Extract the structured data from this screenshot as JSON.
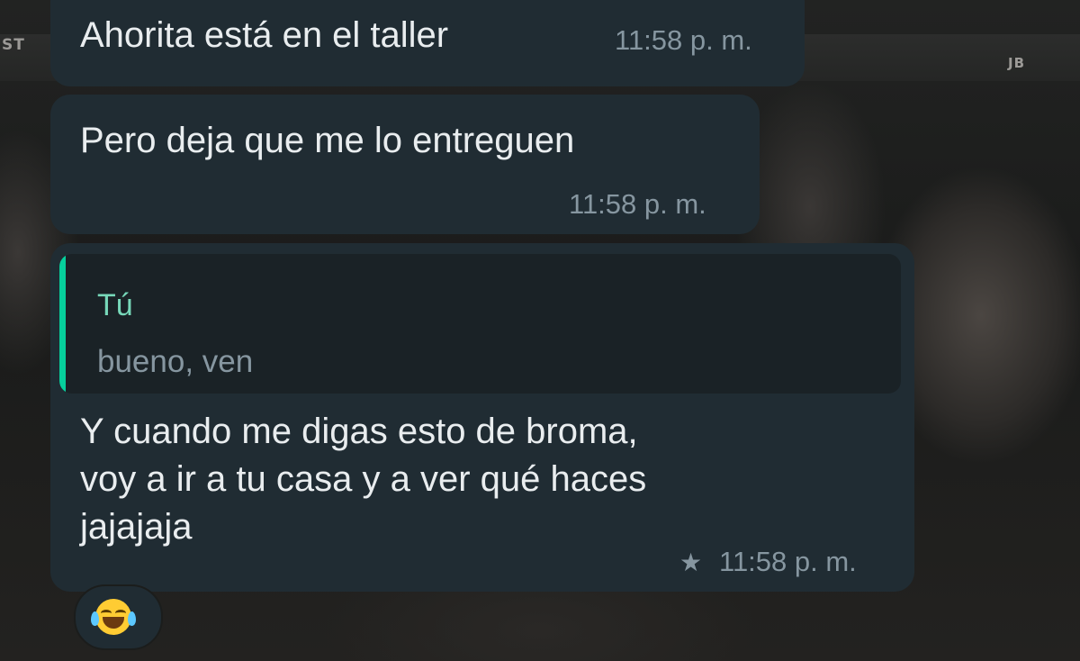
{
  "wallpaper": {
    "tag_left": "ST",
    "tag_right": "JB"
  },
  "messages": [
    {
      "text": "Ahorita está en el taller",
      "time": "11:58 p. m."
    },
    {
      "text": "Pero deja que me lo entreguen",
      "time": "11:58 p. m."
    },
    {
      "quote": {
        "author": "Tú",
        "text": "bueno, ven"
      },
      "lines": [
        "Y cuando me digas esto de broma,",
        "voy a ir a tu casa y a ver qué haces",
        "jajajaja"
      ],
      "starred": true,
      "star_icon": "star-icon",
      "time": "11:58 p. m."
    }
  ],
  "reaction": {
    "emoji_name": "face-with-tears-of-joy-icon"
  },
  "colors": {
    "bubble": "#202c33",
    "quote_bar": "#06cf9c",
    "quote_author": "#77d8b9",
    "meta_text": "#8696a0",
    "message_text": "#e9edef"
  }
}
